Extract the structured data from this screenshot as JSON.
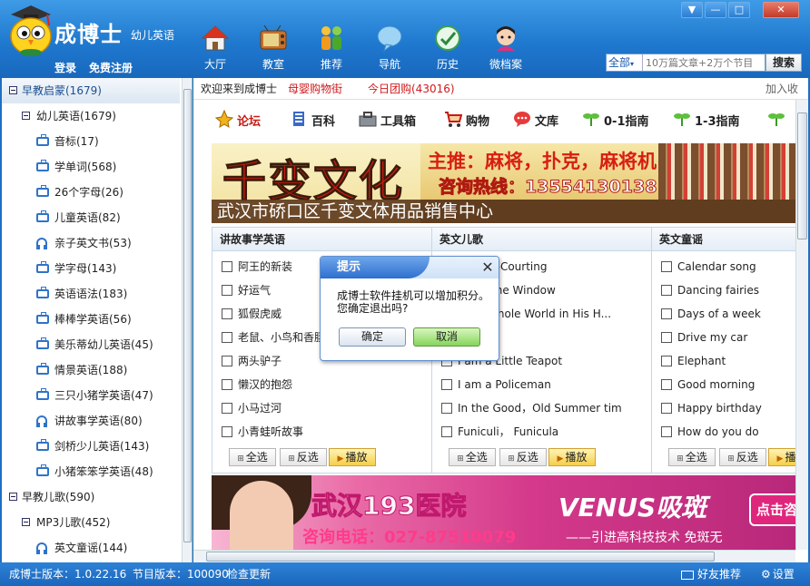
{
  "app": {
    "name": "成博士",
    "subtitle": "幼儿英语",
    "login": "登录",
    "register": "免费注册"
  },
  "colors": {
    "brand_blue": "#1f79cf",
    "link_red": "#d0191b",
    "accent_green": "#86d45a"
  },
  "nav": [
    {
      "label": "大厅",
      "icon": "home-icon"
    },
    {
      "label": "教室",
      "icon": "tv-icon"
    },
    {
      "label": "推荐",
      "icon": "people-icon"
    },
    {
      "label": "导航",
      "icon": "balloon-icon"
    },
    {
      "label": "历史",
      "icon": "history-icon"
    },
    {
      "label": "微档案",
      "icon": "avatar-icon"
    }
  ],
  "window": {
    "menu": "▼",
    "minimize": "—",
    "maximize": "□",
    "close": "✕"
  },
  "search": {
    "category": "全部",
    "placeholder": "10万篇文章+2万个节目",
    "button": "搜索"
  },
  "sidebar": {
    "items": [
      {
        "label": "早教启蒙(1679)",
        "type": "root"
      },
      {
        "label": "幼儿英语(1679)",
        "type": "group"
      },
      {
        "label": "音标(17)",
        "type": "video"
      },
      {
        "label": "学单词(568)",
        "type": "video"
      },
      {
        "label": "26个字母(26)",
        "type": "video"
      },
      {
        "label": "儿童英语(82)",
        "type": "video"
      },
      {
        "label": "亲子英文书(53)",
        "type": "audio"
      },
      {
        "label": "学字母(143)",
        "type": "video"
      },
      {
        "label": "英语语法(183)",
        "type": "video"
      },
      {
        "label": "棒棒学英语(56)",
        "type": "video"
      },
      {
        "label": "美乐蒂幼儿英语(45)",
        "type": "video"
      },
      {
        "label": "情景英语(188)",
        "type": "video"
      },
      {
        "label": "三只小猪学英语(47)",
        "type": "video"
      },
      {
        "label": "讲故事学英语(80)",
        "type": "audio"
      },
      {
        "label": "剑桥少儿英语(143)",
        "type": "video"
      },
      {
        "label": "小猪笨笨学英语(48)",
        "type": "video"
      },
      {
        "label": "早教儿歌(590)",
        "type": "root"
      },
      {
        "label": "MP3儿歌(452)",
        "type": "group"
      },
      {
        "label": "英文童谣(144)",
        "type": "audio"
      }
    ]
  },
  "topbar": {
    "welcome": "欢迎来到成博士",
    "link1": "母婴购物街",
    "link2": "今日团购(43016)",
    "add_fav": "加入收"
  },
  "categories": [
    {
      "label": "论坛",
      "icon": "forum-icon"
    },
    {
      "label": "百科",
      "icon": "book-icon"
    },
    {
      "label": "工具箱",
      "icon": "toolbox-icon"
    },
    {
      "label": "购物",
      "icon": "cart-icon"
    },
    {
      "label": "文库",
      "icon": "chat-icon"
    },
    {
      "label": "0-1指南",
      "icon": "sprout-icon"
    },
    {
      "label": "1-3指南",
      "icon": "sprout-icon"
    }
  ],
  "banner1": {
    "title": "千变文化",
    "promo": "主推：麻将，扑克，麻将机",
    "hotline": "咨询热线：13554130138",
    "store": "武汉市硚口区千变文体用品销售中心"
  },
  "panels": [
    {
      "title": "讲故事学英语",
      "items": [
        "阿王的新装",
        "好运气",
        "狐假虎威",
        "老鼠、小鸟和香肠",
        "两头驴子",
        "懒汉的抱怨",
        "小马过河",
        "小青蛙听故事"
      ]
    },
    {
      "title": "英文儿歌",
      "items": [
        "Went A-Courting",
        "d Out the Window",
        "t the Whole World in His H...",
        "le Baby",
        "I am a Little Teapot",
        "I am a Policeman",
        "In the Good，Old Summer tim",
        "Funiculi， Funicula"
      ]
    },
    {
      "title": "英文童谣",
      "items": [
        "Calendar song",
        "Dancing fairies",
        "Days of a week",
        "Drive my car",
        "Elephant",
        "Good morning",
        "Happy birthday",
        "How do you do"
      ]
    }
  ],
  "panel_buttons": {
    "select_all": "全选",
    "invert": "反选",
    "play": "播放"
  },
  "banner2": {
    "title": "武汉193医院",
    "phone": "咨询电话：027-87510079",
    "brand": "VENUS吸斑",
    "slogan": "——引进高科技技术 免斑无",
    "cta": "点击咨"
  },
  "dialog": {
    "title": "提示",
    "message": "成博士软件挂机可以增加积分。您确定退出吗?",
    "ok": "确定",
    "cancel": "取消"
  },
  "status": {
    "version": "成博士版本：1.0.22.16",
    "program": "节目版本：100090",
    "update": "检查更新",
    "recommend": "好友推荐",
    "settings": "设置"
  }
}
